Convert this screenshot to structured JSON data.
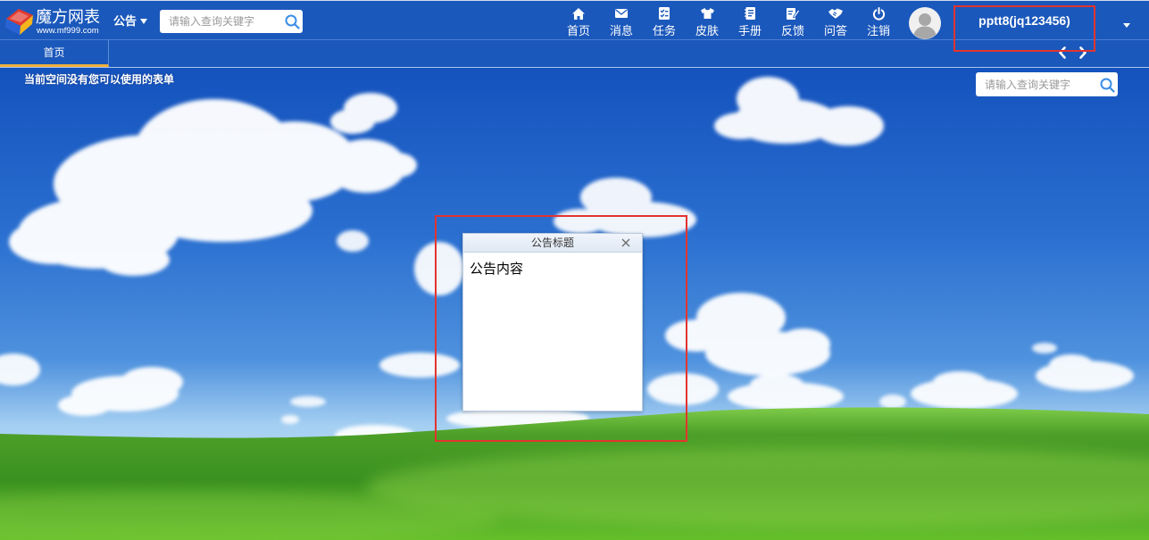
{
  "app": {
    "logo_title": "魔方网表",
    "logo_site": "www.mf999.com",
    "logo_icon": "cube-logo-icon"
  },
  "header": {
    "announcement_label": "公告",
    "search_placeholder": "请输入查询关键字",
    "nav": [
      {
        "label": "首页",
        "icon": "home-icon"
      },
      {
        "label": "消息",
        "icon": "mail-icon"
      },
      {
        "label": "任务",
        "icon": "task-list-icon"
      },
      {
        "label": "皮肤",
        "icon": "shirt-icon"
      },
      {
        "label": "手册",
        "icon": "notebook-icon"
      },
      {
        "label": "反馈",
        "icon": "edit-note-icon"
      },
      {
        "label": "问答",
        "icon": "handshake-icon"
      },
      {
        "label": "注销",
        "icon": "power-icon"
      }
    ],
    "user": {
      "avatar_icon": "user-avatar-icon",
      "username": "pptt8(jq123456)"
    }
  },
  "tabs": [
    {
      "label": "首页",
      "active": true
    }
  ],
  "main": {
    "empty_message": "当前空间没有您可以使用的表单",
    "search_placeholder": "请输入查询关键字"
  },
  "dialog": {
    "title": "公告标题",
    "content": "公告内容"
  },
  "colors": {
    "header_bg": "#1b58bb",
    "tab_accent": "#f0b13a",
    "highlight_box": "#e3342f",
    "search_icon": "#3a8ee6"
  }
}
